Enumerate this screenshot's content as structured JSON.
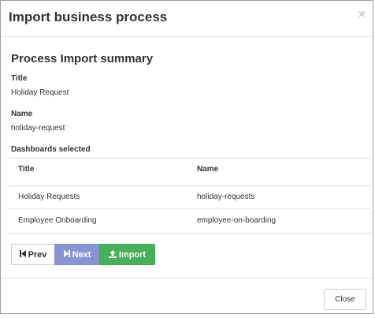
{
  "modal": {
    "title": "Import business process",
    "close_icon": "close-icon"
  },
  "summary": {
    "heading": "Process Import summary",
    "title_label": "Title",
    "title_value": "Holiday Request",
    "name_label": "Name",
    "name_value": "holiday-request",
    "dashboards_label": "Dashboards selected"
  },
  "table": {
    "headers": [
      "Title",
      "Name"
    ],
    "rows": [
      [
        "Holiday Requests",
        "holiday-requests"
      ],
      [
        "Employee Onboarding",
        "employee-on-boarding"
      ]
    ]
  },
  "buttons": {
    "prev_label": "Prev",
    "next_label": "Next",
    "import_label": "Import",
    "prev_icon": "step-backward-icon",
    "next_icon": "step-forward-icon",
    "import_icon": "upload-icon"
  },
  "footer": {
    "close_label": "Close"
  },
  "colors": {
    "next_button": "#8a93d5",
    "import_button": "#46b05a"
  }
}
